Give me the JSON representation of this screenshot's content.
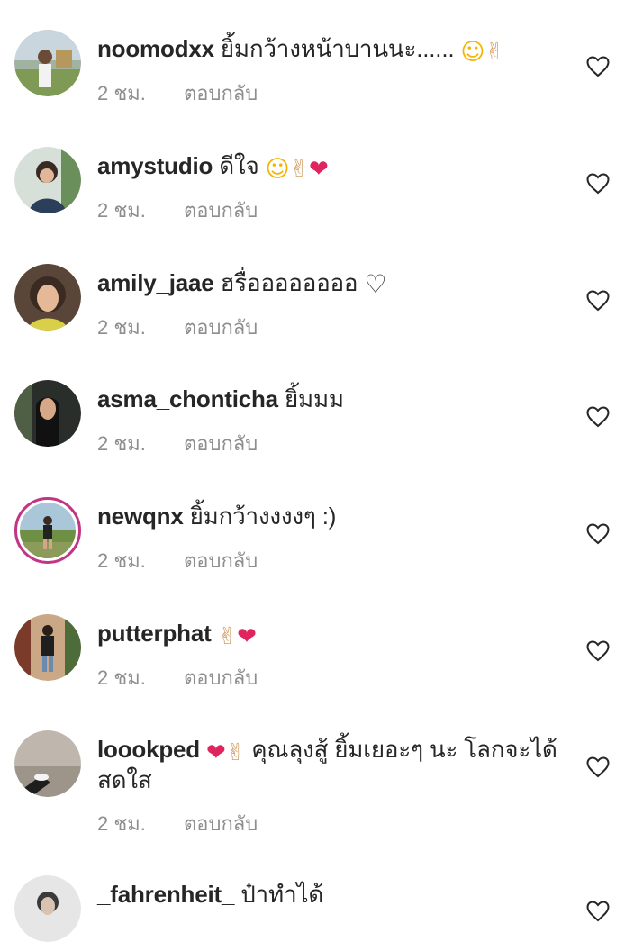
{
  "comments": [
    {
      "username": "noomodxx",
      "text": "ยิ้มกว้างหน้าบานนะ......",
      "emojis": [
        "☺",
        "✌"
      ],
      "time": "2 ชม.",
      "reply": "ตอบกลับ"
    },
    {
      "username": "amystudio",
      "text": "ดีใจ",
      "emojis": [
        "☺",
        "✌",
        "❤"
      ],
      "time": "2 ชม.",
      "reply": "ตอบกลับ"
    },
    {
      "username": "amily_jaae",
      "text": "ฮรื่ออออออออ",
      "emojis": [
        "♡"
      ],
      "time": "2 ชม.",
      "reply": "ตอบกลับ"
    },
    {
      "username": "asma_chonticha",
      "text": "ยิ้มมม",
      "emojis": [],
      "time": "2 ชม.",
      "reply": "ตอบกลับ"
    },
    {
      "username": "newqnx",
      "text": "ยิ้มกว้างงงงๆ :)",
      "emojis": [],
      "time": "2 ชม.",
      "reply": "ตอบกลับ"
    },
    {
      "username": "putterphat",
      "text": "",
      "emojis": [
        "✌",
        "❤"
      ],
      "time": "2 ชม.",
      "reply": "ตอบกลับ"
    },
    {
      "username": "loookped",
      "text_before": "",
      "emojis": [
        "❤",
        "✌"
      ],
      "text": "คุณลุงสู้ ยิ้มเยอะๆ นะ โลกจะได้สดใส",
      "time": "2 ชม.",
      "reply": "ตอบกลับ"
    },
    {
      "username": "_fahrenheit_",
      "text": "ป๋าทำได้",
      "emojis": [],
      "time": "",
      "reply": ""
    }
  ],
  "icons": {
    "like": "heart-outline-icon"
  },
  "colors": {
    "username": "#262626",
    "meta": "#8e8e8e",
    "story_ring": "#c13584",
    "heart_red": "#e0245e"
  }
}
